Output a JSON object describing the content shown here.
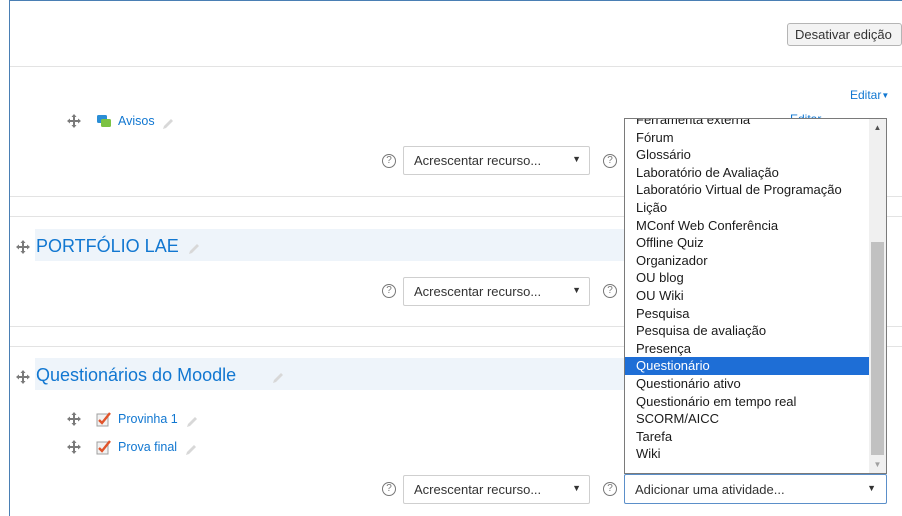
{
  "toolbar": {
    "edit_toggle_label": "Desativar edição"
  },
  "general": {
    "editar_label": "Editar",
    "editar_partial": "Editar",
    "resources": [
      {
        "name": "Avisos",
        "icon": "forum-icon"
      }
    ]
  },
  "sections": [
    {
      "title": "PORTFÓLIO LAE",
      "resources": []
    },
    {
      "title": "Questionários do Moodle",
      "resources": [
        {
          "name": "Provinha 1",
          "icon": "quiz-icon"
        },
        {
          "name": "Prova final",
          "icon": "quiz-icon"
        }
      ]
    }
  ],
  "add_resource": {
    "label": "Acrescentar recurso..."
  },
  "add_activity": {
    "label": "Adicionar uma atividade..."
  },
  "activity_dropdown": {
    "items": [
      "Ferramenta externa",
      "Fórum",
      "Glossário",
      "Laboratório de Avaliação",
      "Laboratório Virtual de Programação",
      "Lição",
      "MConf Web Conferência",
      "Offline Quiz",
      "Organizador",
      "OU blog",
      "OU Wiki",
      "Pesquisa",
      "Pesquisa de avaliação",
      "Presença",
      "Questionário",
      "Questionário ativo",
      "Questionário em tempo real",
      "SCORM/AICC",
      "Tarefa",
      "Wiki"
    ],
    "selected": "Questionário"
  },
  "colors": {
    "link": "#1177d1",
    "selected": "#1e6ed6",
    "section_bg": "#eef4fa"
  }
}
